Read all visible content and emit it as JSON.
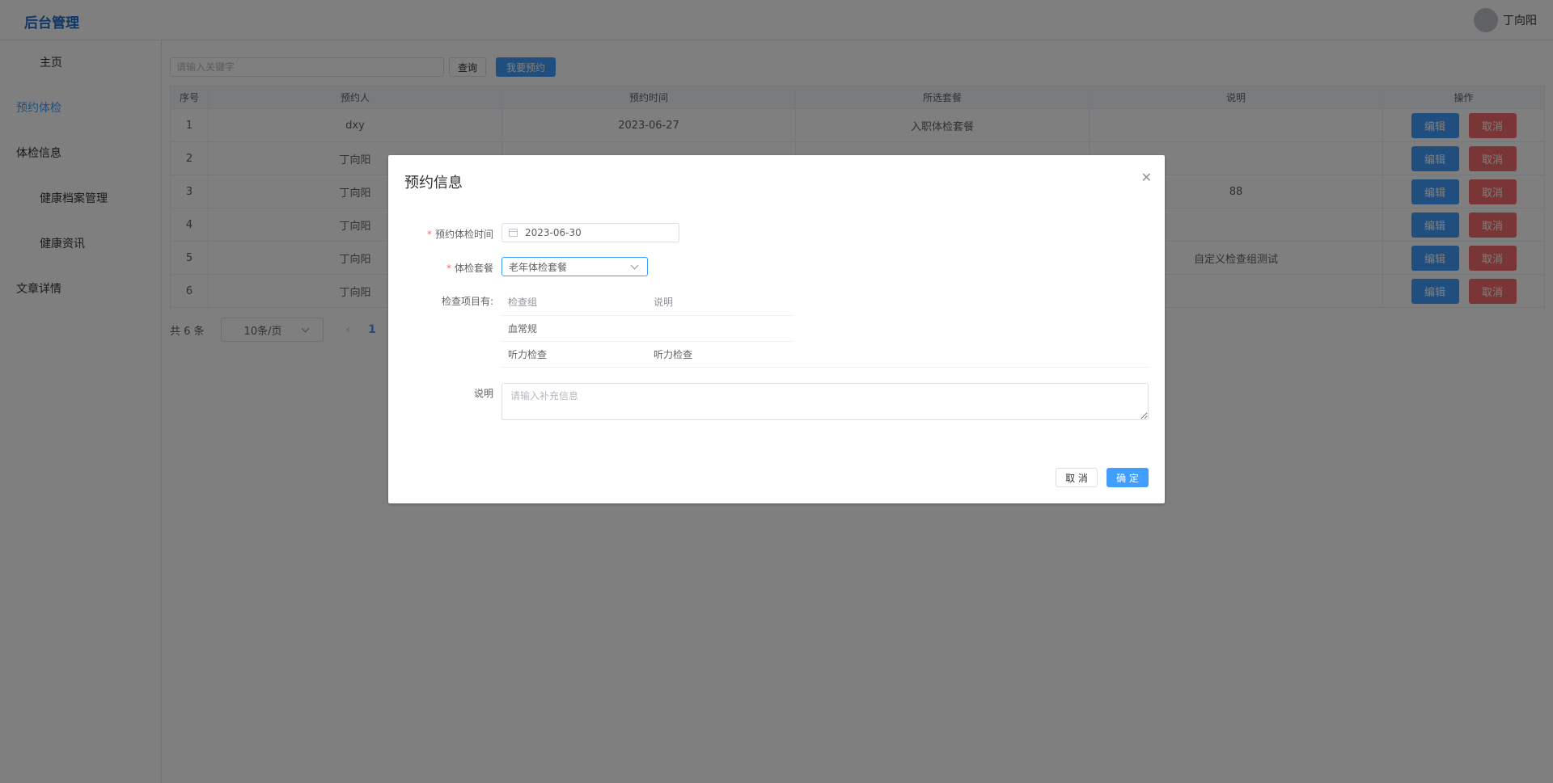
{
  "header": {
    "brand": "后台管理",
    "user_name": "丁向阳"
  },
  "sidebar": {
    "items": [
      {
        "label": "主页"
      },
      {
        "label": "预约体检"
      },
      {
        "label": "体检信息"
      },
      {
        "label": "健康档案管理"
      },
      {
        "label": "健康资讯"
      },
      {
        "label": "文章详情"
      }
    ]
  },
  "toolbar": {
    "search_placeholder": "请输入关键字",
    "query_label": "查询",
    "book_label": "我要预约"
  },
  "table": {
    "headers": [
      "序号",
      "预约人",
      "预约时间",
      "所选套餐",
      "说明",
      "操作"
    ],
    "rows": [
      {
        "index": "1",
        "person": "dxy",
        "time": "2023-06-27",
        "package": "入职体检套餐",
        "note": ""
      },
      {
        "index": "2",
        "person": "丁向阳",
        "time": "",
        "package": "",
        "note": ""
      },
      {
        "index": "3",
        "person": "丁向阳",
        "time": "",
        "package": "",
        "note": "88"
      },
      {
        "index": "4",
        "person": "丁向阳",
        "time": "",
        "package": "",
        "note": ""
      },
      {
        "index": "5",
        "person": "丁向阳",
        "time": "",
        "package": "",
        "note": "自定义检查组测试"
      },
      {
        "index": "6",
        "person": "丁向阳",
        "time": "",
        "package": "",
        "note": ""
      }
    ],
    "edit_label": "编辑",
    "cancel_label": "取消"
  },
  "pager": {
    "total": "共 6 条",
    "page_size": "10条/页",
    "current_page": "1"
  },
  "dialog": {
    "title": "预约信息",
    "date_label": "预约体检时间",
    "date_value": "2023-06-30",
    "package_label": "体检套餐",
    "package_value": "老年体检套餐",
    "items_label": "检查项目有:",
    "items_headers": [
      "检查组",
      "说明"
    ],
    "items": [
      {
        "group": "血常规",
        "note": ""
      },
      {
        "group": "听力检查",
        "note": "听力检查"
      }
    ],
    "note_label": "说明",
    "note_placeholder": "请输入补充信息",
    "cancel_label": "取 消",
    "ok_label": "确 定"
  },
  "colors": {
    "primary": "#409eff",
    "danger": "#f56c6c",
    "brand": "#1e6fd1"
  }
}
